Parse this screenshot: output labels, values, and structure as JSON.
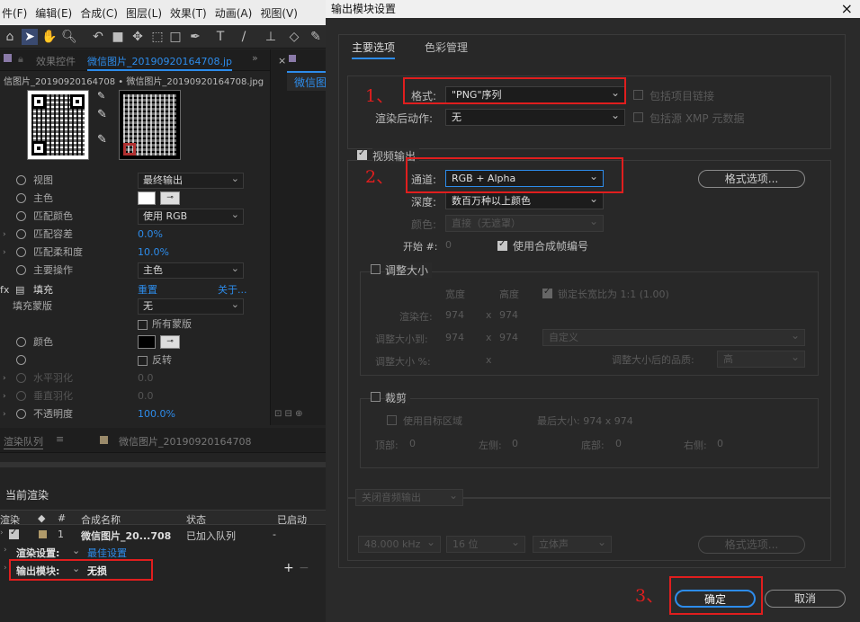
{
  "menu": [
    "件(F)",
    "编辑(E)",
    "合成(C)",
    "图层(L)",
    "效果(T)",
    "动画(A)",
    "视图(V)"
  ],
  "left_panel": {
    "tab_effects": "效果控件",
    "tab_effects_file": "微信图片_20190920164708.jp",
    "breadcrumb": "信图片_20190920164708 • 微信图片_20190920164708.jpg",
    "right_tab": "微信图",
    "rows": [
      {
        "label": "视图",
        "value": "最终输出"
      },
      {
        "label": "主色",
        "value": ""
      },
      {
        "label": "匹配颜色",
        "value": "使用 RGB"
      },
      {
        "label": "匹配容差",
        "value": "0.0%"
      },
      {
        "label": "匹配柔和度",
        "value": "10.0%"
      },
      {
        "label": "主要操作",
        "value": "主色"
      },
      {
        "label": "填充",
        "value": "重置",
        "extra": "关于..."
      },
      {
        "label": "填充蒙版",
        "value": "无"
      },
      {
        "label": "",
        "value": "所有蒙版"
      },
      {
        "label": "颜色",
        "value": ""
      },
      {
        "label": "",
        "value": "反转"
      },
      {
        "label": "水平羽化",
        "value": "0.0"
      },
      {
        "label": "垂直羽化",
        "value": "0.0"
      },
      {
        "label": "不透明度",
        "value": "100.0%"
      }
    ]
  },
  "render_queue": {
    "tab": "渲染队列",
    "tab2": "微信图片_20190920164708",
    "current": "当前渲染",
    "headers": [
      "渲染",
      "#",
      "合成名称",
      "状态",
      "已启动"
    ],
    "row": {
      "num": "1",
      "name": "微信图片_20...708",
      "status": "已加入队列",
      "started": "-"
    },
    "render_settings_label": "渲染设置:",
    "render_settings_value": "最佳设置",
    "output_module_label": "输出模块:",
    "output_module_value": "无损"
  },
  "dialog": {
    "title": "输出模块设置",
    "tabs": [
      "主要选项",
      "色彩管理"
    ],
    "format_label": "格式:",
    "format_value": "\"PNG\"序列",
    "post_render_label": "渲染后动作:",
    "post_render_value": "无",
    "include_project_link": "包括项目链接",
    "include_xmp": "包括源 XMP 元数据",
    "video_output": "视频输出",
    "channels_label": "通道:",
    "channels_value": "RGB + Alpha",
    "format_options": "格式选项...",
    "depth_label": "深度:",
    "depth_value": "数百万种以上颜色",
    "color_label": "颜色:",
    "color_value": "直接（无遮罩）",
    "start_label": "开始 #:",
    "start_value": "0",
    "use_comp_frame": "使用合成帧编号",
    "resize": "调整大小",
    "width": "宽度",
    "height": "高度",
    "lock_ratio": "锁定长宽比为 1:1 (1.00)",
    "render_at": "渲染在:",
    "render_w": "974",
    "render_h": "974",
    "resize_to": "调整大小到:",
    "resize_w": "974",
    "resize_h": "974",
    "resize_preset": "自定义",
    "resize_pct": "调整大小 %:",
    "resize_quality_label": "调整大小后的品质:",
    "resize_quality": "高",
    "crop": "裁剪",
    "use_roi": "使用目标区域",
    "final_size": "最后大小: 974 x 974",
    "top": "顶部:",
    "left": "左侧:",
    "bottom": "底部:",
    "right": "右侧:",
    "top_v": "0",
    "left_v": "0",
    "bottom_v": "0",
    "right_v": "0",
    "audio_output": "关闭音频输出",
    "audio_rate": "48.000 kHz",
    "audio_bits": "16 位",
    "audio_ch": "立体声",
    "audio_options": "格式选项...",
    "ok": "确定",
    "cancel": "取消",
    "ann1": "1、",
    "ann2": "2、",
    "ann3": "3、"
  },
  "colors": {
    "accent": "#2d8ceb",
    "annotation": "#e01e1e"
  }
}
